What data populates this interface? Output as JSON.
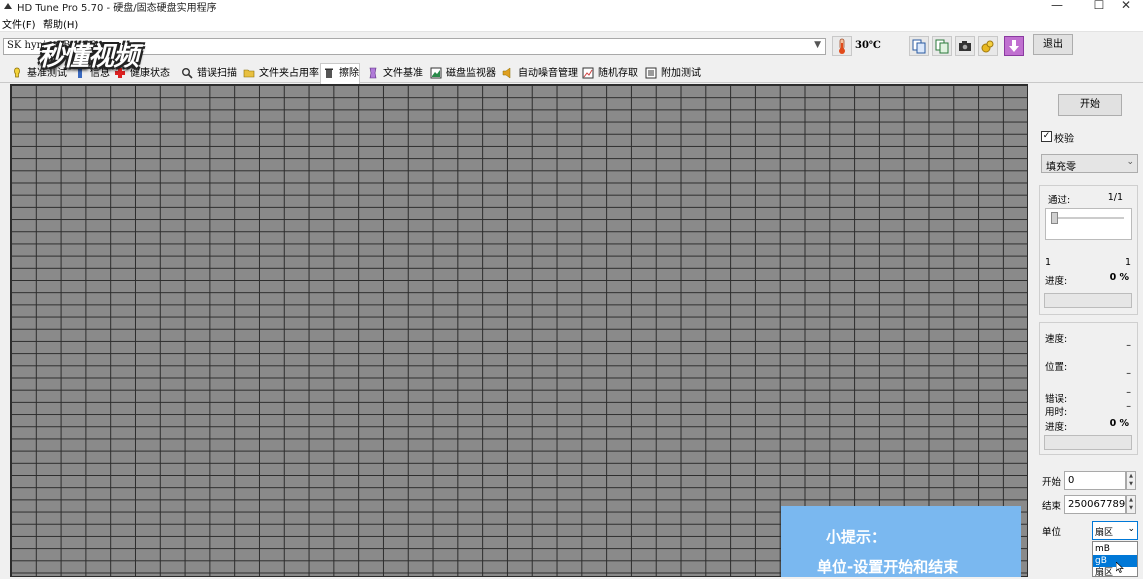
{
  "window": {
    "title": "HD Tune Pro 5.70 - 硬盘/固态硬盘实用程序",
    "minimize": "—",
    "maximize": "☐",
    "close": "✕"
  },
  "menu": {
    "file": "文件(F)",
    "help": "帮助(H)"
  },
  "toolbar": {
    "drive": "SK hynix        GB (128",
    "temperature": "30℃",
    "exit_label": "退出"
  },
  "tabs": [
    {
      "label": "基准测试",
      "icon": "benchmark-icon"
    },
    {
      "label": "信息",
      "icon": "info-icon"
    },
    {
      "label": "健康状态",
      "icon": "health-icon"
    },
    {
      "label": "错误扫描",
      "icon": "error-scan-icon"
    },
    {
      "label": "文件夹占用率",
      "icon": "folder-icon"
    },
    {
      "label": "擦除",
      "icon": "erase-icon"
    },
    {
      "label": "文件基准",
      "icon": "file-benchmark-icon"
    },
    {
      "label": "磁盘监视器",
      "icon": "disk-monitor-icon"
    },
    {
      "label": "自动噪音管理",
      "icon": "speaker-icon"
    },
    {
      "label": "随机存取",
      "icon": "random-access-icon"
    },
    {
      "label": "附加测试",
      "icon": "extra-tests-icon"
    }
  ],
  "active_tab": "擦除",
  "panel": {
    "start_label": "开始",
    "verify_label": "校验",
    "verify_checked": true,
    "fill_mode": "填充零",
    "passes_label": "通过:",
    "passes_value": "1/1",
    "slider_min": "1",
    "slider_max": "1",
    "progress_label": "进度:",
    "progress_value": "0 %",
    "speed_label": "速度:",
    "speed_value": "–",
    "position_label": "位置:",
    "position_value": "–",
    "errors_label": "错误:",
    "errors_value": "–",
    "elapsed_label": "用时:",
    "elapsed_value": "–",
    "progress2_label": "进度:",
    "progress2_value": "0 %",
    "start_field_label": "开始",
    "start_field_value": "0",
    "end_field_label": "结束",
    "end_field_value": "250067789",
    "unit_label": "单位",
    "unit_value": "扇区",
    "unit_options": [
      "mB",
      "gB",
      "扇区"
    ],
    "unit_highlighted": "gB"
  },
  "overlay": {
    "watermark": "秒懂视频",
    "hint_title": "小提示：",
    "hint_text": "单位-设置开始和结束"
  }
}
